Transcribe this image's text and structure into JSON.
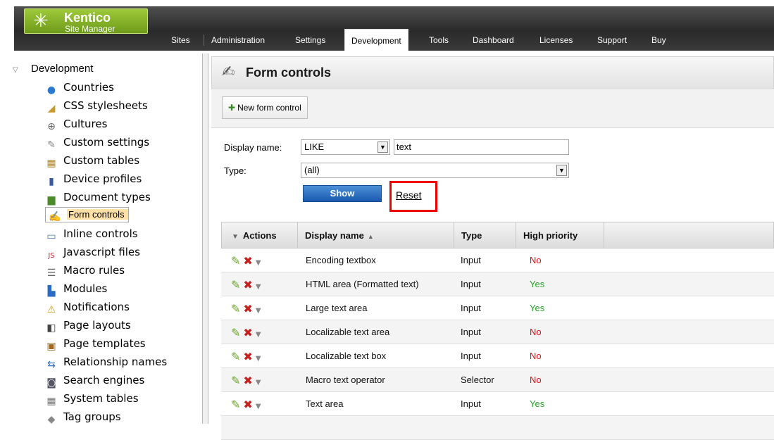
{
  "app": {
    "logo_name": "Kentico",
    "logo_sub": "Site Manager"
  },
  "nav": [
    "Sites",
    "Administration",
    "Settings",
    "Development",
    "Tools",
    "Dashboard",
    "Licenses",
    "Support",
    "Buy"
  ],
  "nav_active": "Development",
  "sidebar": {
    "root": "Development",
    "items": [
      {
        "label": "Countries",
        "icon": "globe-icon"
      },
      {
        "label": "CSS stylesheets",
        "icon": "brush-icon"
      },
      {
        "label": "Cultures",
        "icon": "globe-outline-icon"
      },
      {
        "label": "Custom settings",
        "icon": "wrench-icon"
      },
      {
        "label": "Custom tables",
        "icon": "table-icon"
      },
      {
        "label": "Device profiles",
        "icon": "device-icon"
      },
      {
        "label": "Document types",
        "icon": "book-icon"
      },
      {
        "label": "Form controls",
        "icon": "form-control-icon"
      },
      {
        "label": "Inline controls",
        "icon": "inline-control-icon"
      },
      {
        "label": "Javascript files",
        "icon": "js-file-icon"
      },
      {
        "label": "Macro rules",
        "icon": "macro-rule-icon"
      },
      {
        "label": "Modules",
        "icon": "modules-icon"
      },
      {
        "label": "Notifications",
        "icon": "notification-icon"
      },
      {
        "label": "Page layouts",
        "icon": "page-layout-icon"
      },
      {
        "label": "Page templates",
        "icon": "page-template-icon"
      },
      {
        "label": "Relationship names",
        "icon": "relationship-icon"
      },
      {
        "label": "Search engines",
        "icon": "search-engine-icon"
      },
      {
        "label": "System tables",
        "icon": "system-table-icon"
      },
      {
        "label": "Tag groups",
        "icon": "tag-icon"
      }
    ],
    "selected": "Form controls"
  },
  "page": {
    "title": "Form controls",
    "new_button": "New form control"
  },
  "filter": {
    "display_name_label": "Display name:",
    "operator": "LIKE",
    "text": "text",
    "type_label": "Type:",
    "type_value": "(all)",
    "show": "Show",
    "reset": "Reset"
  },
  "grid": {
    "columns": [
      "Actions",
      "Display name",
      "Type",
      "High priority"
    ],
    "rows": [
      {
        "name": "Encoding textbox",
        "type": "Input",
        "priority": "No"
      },
      {
        "name": "HTML area (Formatted text)",
        "type": "Input",
        "priority": "Yes"
      },
      {
        "name": "Large text area",
        "type": "Input",
        "priority": "Yes"
      },
      {
        "name": "Localizable text area",
        "type": "Input",
        "priority": "No"
      },
      {
        "name": "Localizable text box",
        "type": "Input",
        "priority": "No"
      },
      {
        "name": "Macro text operator",
        "type": "Selector",
        "priority": "No"
      },
      {
        "name": "Text area",
        "type": "Input",
        "priority": "Yes"
      }
    ]
  },
  "colors": {
    "yes": "#2aa52a",
    "no": "#e01010",
    "selected_bg": "#fce0a6",
    "highlight_box": "#e00000"
  }
}
